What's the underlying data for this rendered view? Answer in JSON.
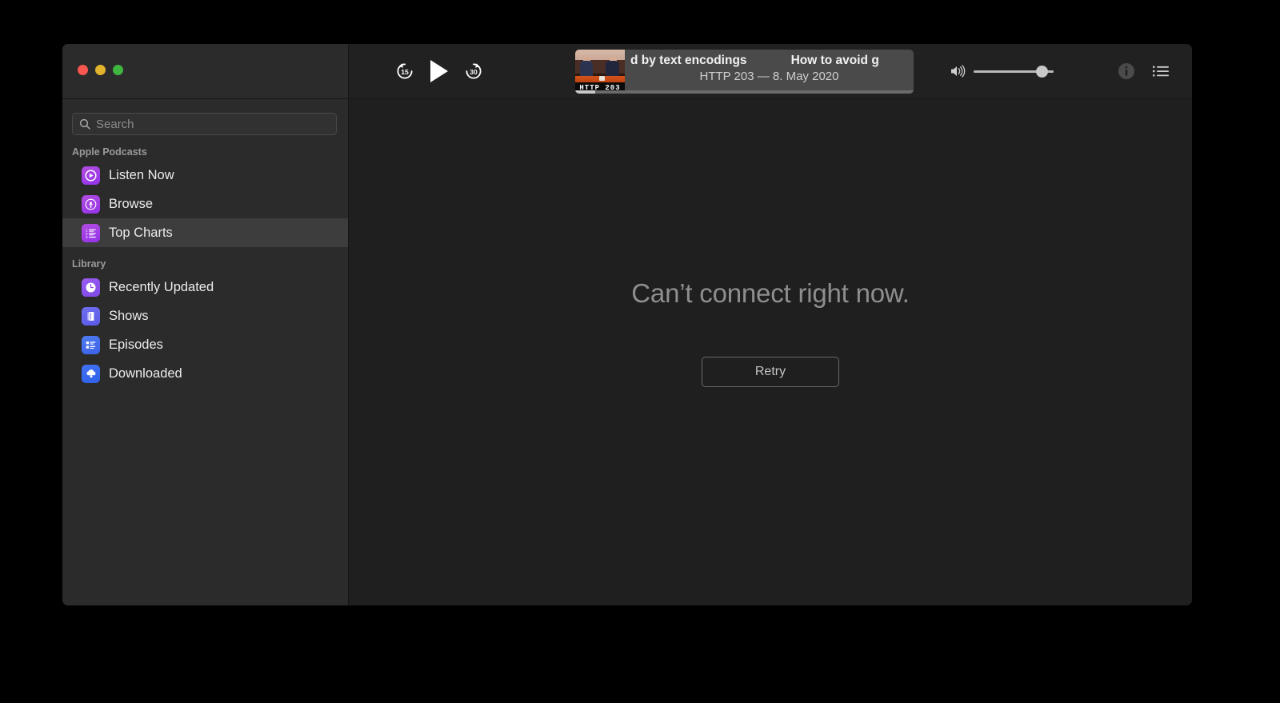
{
  "window": {
    "traffic_lights": [
      {
        "name": "close",
        "color": "#f9564f"
      },
      {
        "name": "minimize",
        "color": "#e2b32c"
      },
      {
        "name": "maximize",
        "color": "#3fb63f"
      }
    ]
  },
  "toolbar": {
    "skip_back_label": "15",
    "skip_forward_label": "30",
    "play_icon": "play-icon",
    "skip_back_icon": "skip-back-15-icon",
    "skip_forward_icon": "skip-forward-30-icon",
    "volume_icon": "volume-high-icon",
    "volume_percent": 82,
    "info_icon": "info-circle-icon",
    "up_next_icon": "up-next-list-icon"
  },
  "now_playing": {
    "title_fragment_1": "d by text encodings",
    "title_fragment_2": "How to avoid g",
    "subtitle": "HTTP 203 — 8. May 2020",
    "artwork_label": "HTTP 203",
    "artwork_alt": "two-people-at-table-artwork",
    "progress_percent": 6
  },
  "search": {
    "placeholder": "Search",
    "value": "",
    "icon": "search-icon"
  },
  "sidebar": {
    "sections": [
      {
        "title": "Apple Podcasts",
        "items": [
          {
            "label": "Listen Now",
            "icon": "listen-now-icon",
            "selected": false
          },
          {
            "label": "Browse",
            "icon": "browse-antenna-icon",
            "selected": false
          },
          {
            "label": "Top Charts",
            "icon": "top-charts-list-icon",
            "selected": true
          }
        ]
      },
      {
        "title": "Library",
        "items": [
          {
            "label": "Recently Updated",
            "icon": "clock-icon",
            "selected": false
          },
          {
            "label": "Shows",
            "icon": "books-icon",
            "selected": false
          },
          {
            "label": "Episodes",
            "icon": "episodes-list-icon",
            "selected": false
          },
          {
            "label": "Downloaded",
            "icon": "cloud-download-icon",
            "selected": false
          }
        ]
      }
    ]
  },
  "content": {
    "error_title": "Can’t connect right now.",
    "retry_label": "Retry"
  },
  "colors": {
    "sidebar_bg": "#2b2b2b",
    "content_bg": "#1f1f1f",
    "toolbar_bg": "#212121",
    "selected_row": "#3d3d3d",
    "now_playing_bg": "#4a4a4a"
  }
}
